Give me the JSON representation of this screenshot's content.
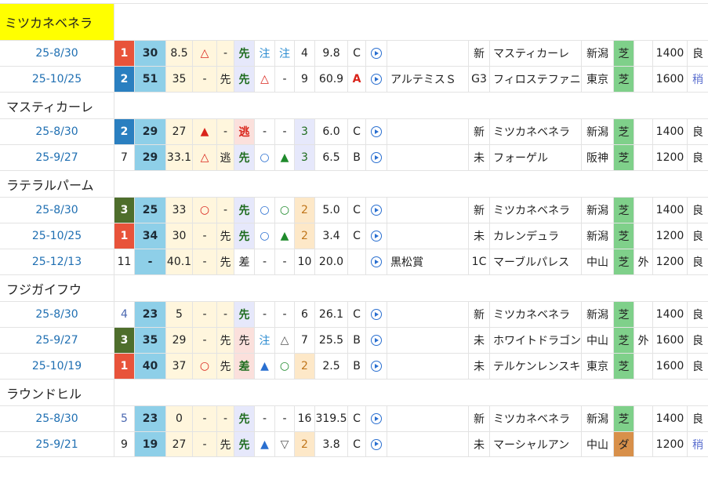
{
  "horses": [
    {
      "name": "ミツカネベネラ",
      "highlight": true,
      "races": [
        {
          "date": "25-8/30",
          "rank": "1",
          "rank_style": "r1",
          "horse_no": "30",
          "weight_ago": "8.5",
          "m1": "△",
          "m1c": "mk-red",
          "m2": "-",
          "pos": "先",
          "pos_style": "sen",
          "m3": "注",
          "m3c": "mk-cyan",
          "m4": "注",
          "m4c": "mk-cyan",
          "pop": "4",
          "pop_style": "",
          "odds": "9.8",
          "grade": "C",
          "grade_style": "",
          "race_name": "",
          "cls": "新",
          "winner": "マスティカーレ",
          "course": "新潟",
          "surface": "芝",
          "surf_style": "surf-t",
          "extra": "",
          "dist": "1400",
          "cond": "良",
          "cond_style": ""
        },
        {
          "date": "25-10/25",
          "rank": "2",
          "rank_style": "r2",
          "horse_no": "51",
          "weight_ago": "35",
          "m1": "-",
          "m1c": "",
          "m2": "先",
          "pos": "先",
          "pos_style": "sen",
          "m3": "△",
          "m3c": "mk-red",
          "m4": "-",
          "m4c": "",
          "pop": "9",
          "pop_style": "",
          "odds": "60.9",
          "grade": "A",
          "grade_style": "grade-a",
          "race_name": "アルテミスＳ",
          "cls": "G3",
          "winner": "フィロステファニ",
          "course": "東京",
          "surface": "芝",
          "surf_style": "surf-t",
          "extra": "",
          "dist": "1600",
          "cond": "稍",
          "cond_style": "cond-b"
        }
      ]
    },
    {
      "name": "マスティカーレ",
      "highlight": false,
      "races": [
        {
          "date": "25-8/30",
          "rank": "2",
          "rank_style": "r2",
          "horse_no": "29",
          "weight_ago": "27",
          "m1": "▲",
          "m1c": "mk-red",
          "m2": "-",
          "pos": "逃",
          "pos_style": "nige",
          "m3": "-",
          "m3c": "",
          "m4": "-",
          "m4c": "",
          "pop": "3",
          "pop_style": "hi3",
          "odds": "6.0",
          "grade": "C",
          "grade_style": "",
          "race_name": "",
          "cls": "新",
          "winner": "ミツカネベネラ",
          "course": "新潟",
          "surface": "芝",
          "surf_style": "surf-t",
          "extra": "",
          "dist": "1400",
          "cond": "良",
          "cond_style": ""
        },
        {
          "date": "25-9/27",
          "rank": "7",
          "rank_style": "",
          "horse_no": "29",
          "weight_ago": "33.1",
          "m1": "△",
          "m1c": "mk-red",
          "m2": "逃",
          "pos": "先",
          "pos_style": "sen",
          "m3": "○",
          "m3c": "mk-blue",
          "m4": "▲",
          "m4c": "mk-green",
          "pop": "3",
          "pop_style": "hi3",
          "odds": "6.5",
          "grade": "B",
          "grade_style": "",
          "race_name": "",
          "cls": "未",
          "winner": "フォーゲル",
          "course": "阪神",
          "surface": "芝",
          "surf_style": "surf-t",
          "extra": "",
          "dist": "1200",
          "cond": "良",
          "cond_style": ""
        }
      ]
    },
    {
      "name": "ラテラルパーム",
      "highlight": false,
      "races": [
        {
          "date": "25-8/30",
          "rank": "3",
          "rank_style": "r3",
          "horse_no": "25",
          "weight_ago": "33",
          "m1": "○",
          "m1c": "mk-red",
          "m2": "-",
          "pos": "先",
          "pos_style": "sen",
          "m3": "○",
          "m3c": "mk-blue",
          "m4": "○",
          "m4c": "mk-green",
          "pop": "2",
          "pop_style": "hi",
          "odds": "5.0",
          "grade": "C",
          "grade_style": "",
          "race_name": "",
          "cls": "新",
          "winner": "ミツカネベネラ",
          "course": "新潟",
          "surface": "芝",
          "surf_style": "surf-t",
          "extra": "",
          "dist": "1400",
          "cond": "良",
          "cond_style": ""
        },
        {
          "date": "25-10/25",
          "rank": "1",
          "rank_style": "r1",
          "horse_no": "34",
          "weight_ago": "30",
          "m1": "-",
          "m1c": "",
          "m2": "先",
          "pos": "先",
          "pos_style": "sen",
          "m3": "○",
          "m3c": "mk-blue",
          "m4": "▲",
          "m4c": "mk-green",
          "pop": "2",
          "pop_style": "hi",
          "odds": "3.4",
          "grade": "C",
          "grade_style": "",
          "race_name": "",
          "cls": "未",
          "winner": "カレンデュラ",
          "course": "新潟",
          "surface": "芝",
          "surf_style": "surf-t",
          "extra": "",
          "dist": "1200",
          "cond": "良",
          "cond_style": ""
        },
        {
          "date": "25-12/13",
          "rank": "11",
          "rank_style": "",
          "horse_no": "-",
          "weight_ago": "40.1",
          "m1": "-",
          "m1c": "",
          "m2": "先",
          "pos": "差",
          "pos_style": "",
          "m3": "-",
          "m3c": "",
          "m4": "-",
          "m4c": "",
          "pop": "10",
          "pop_style": "",
          "odds": "20.0",
          "grade": "",
          "grade_style": "",
          "race_name": "黒松賞",
          "cls": "1C",
          "winner": "マーブルパレス",
          "course": "中山",
          "surface": "芝",
          "surf_style": "surf-t",
          "extra": "外",
          "dist": "1200",
          "cond": "良",
          "cond_style": ""
        }
      ]
    },
    {
      "name": "フジガイフウ",
      "highlight": false,
      "races": [
        {
          "date": "25-8/30",
          "rank": "4",
          "rank_style": "rg",
          "horse_no": "23",
          "weight_ago": "5",
          "m1": "-",
          "m1c": "",
          "m2": "-",
          "pos": "先",
          "pos_style": "sen",
          "m3": "-",
          "m3c": "",
          "m4": "-",
          "m4c": "",
          "pop": "6",
          "pop_style": "",
          "odds": "26.1",
          "grade": "C",
          "grade_style": "",
          "race_name": "",
          "cls": "新",
          "winner": "ミツカネベネラ",
          "course": "新潟",
          "surface": "芝",
          "surf_style": "surf-t",
          "extra": "",
          "dist": "1400",
          "cond": "良",
          "cond_style": ""
        },
        {
          "date": "25-9/27",
          "rank": "3",
          "rank_style": "r3",
          "horse_no": "35",
          "weight_ago": "29",
          "m1": "-",
          "m1c": "",
          "m2": "先",
          "pos": "先",
          "pos_style": "sen2",
          "m3": "注",
          "m3c": "mk-cyan",
          "m4": "△",
          "m4c": "mk-gray",
          "pop": "7",
          "pop_style": "",
          "odds": "25.5",
          "grade": "B",
          "grade_style": "",
          "race_name": "",
          "cls": "未",
          "winner": "ホワイトドラゴン",
          "course": "中山",
          "surface": "芝",
          "surf_style": "surf-t",
          "extra": "外",
          "dist": "1600",
          "cond": "良",
          "cond_style": ""
        },
        {
          "date": "25-10/19",
          "rank": "1",
          "rank_style": "r1",
          "horse_no": "40",
          "weight_ago": "37",
          "m1": "○",
          "m1c": "mk-red",
          "m2": "先",
          "pos": "差",
          "pos_style": "sa",
          "m3": "▲",
          "m3c": "mk-blue",
          "m4": "○",
          "m4c": "mk-green",
          "pop": "2",
          "pop_style": "hi",
          "odds": "2.5",
          "grade": "B",
          "grade_style": "",
          "race_name": "",
          "cls": "未",
          "winner": "テルケンレンスキー",
          "course": "東京",
          "surface": "芝",
          "surf_style": "surf-t",
          "extra": "",
          "dist": "1600",
          "cond": "良",
          "cond_style": ""
        }
      ]
    },
    {
      "name": "ラウンドヒル",
      "highlight": false,
      "races": [
        {
          "date": "25-8/30",
          "rank": "5",
          "rank_style": "rg",
          "horse_no": "23",
          "weight_ago": "0",
          "m1": "-",
          "m1c": "",
          "m2": "-",
          "pos": "先",
          "pos_style": "sen",
          "m3": "-",
          "m3c": "",
          "m4": "-",
          "m4c": "",
          "pop": "16",
          "pop_style": "",
          "odds": "319.5",
          "grade": "C",
          "grade_style": "",
          "race_name": "",
          "cls": "新",
          "winner": "ミツカネベネラ",
          "course": "新潟",
          "surface": "芝",
          "surf_style": "surf-t",
          "extra": "",
          "dist": "1400",
          "cond": "良",
          "cond_style": ""
        },
        {
          "date": "25-9/21",
          "rank": "9",
          "rank_style": "",
          "horse_no": "19",
          "weight_ago": "27",
          "m1": "-",
          "m1c": "",
          "m2": "先",
          "pos": "先",
          "pos_style": "sen",
          "m3": "▲",
          "m3c": "mk-blue",
          "m4": "▽",
          "m4c": "mk-gray",
          "pop": "2",
          "pop_style": "hi",
          "odds": "3.8",
          "grade": "C",
          "grade_style": "",
          "race_name": "",
          "cls": "未",
          "winner": "マーシャルアン",
          "course": "中山",
          "surface": "ダ",
          "surf_style": "surf-d",
          "extra": "",
          "dist": "1200",
          "cond": "稍",
          "cond_style": "cond-b"
        }
      ]
    }
  ]
}
